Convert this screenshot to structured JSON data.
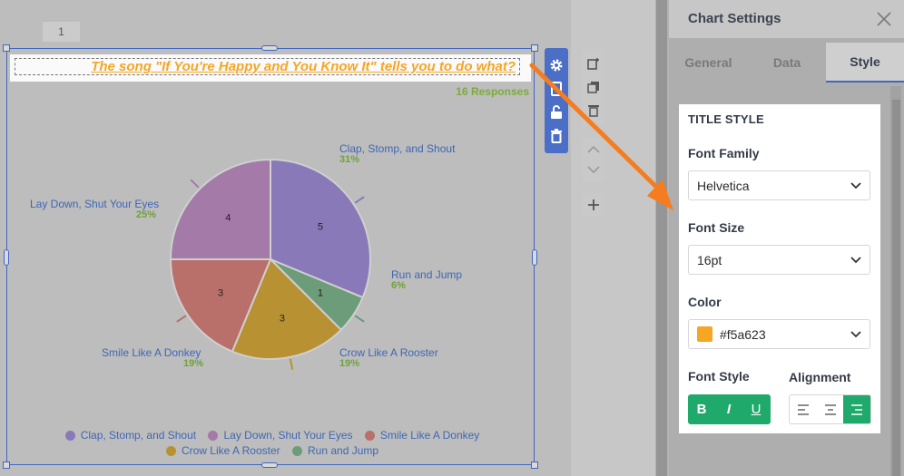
{
  "editor": {
    "page_number": "1",
    "question_title": "The song \"If You're Happy and You Know It\" tells you to do what?",
    "responses": "16 Responses"
  },
  "chart_data": {
    "type": "pie",
    "title": "The song \"If You're Happy and You Know It\" tells you to do what?",
    "categories": [
      "Clap, Stomp, and Shout",
      "Run and Jump",
      "Crow Like A Rooster",
      "Smile Like A Donkey",
      "Lay Down, Shut Your Eyes"
    ],
    "values": [
      5,
      1,
      3,
      3,
      4
    ],
    "percentages": [
      "31%",
      "6%",
      "19%",
      "19%",
      "25%"
    ],
    "colors": [
      "#8a79b9",
      "#6c9c79",
      "#b89133",
      "#b9706b",
      "#a47aa8"
    ],
    "legend_order": [
      "Clap, Stomp, and Shout",
      "Lay Down, Shut Your Eyes",
      "Smile Like A Donkey",
      "Crow Like A Rooster",
      "Run and Jump"
    ],
    "legend_position": "bottom"
  },
  "toolbar_icons": [
    "gear-icon",
    "copy-icon",
    "unlock-icon",
    "trash-icon"
  ],
  "aux_icons": [
    "add-image-icon",
    "duplicate-icon",
    "delete-icon",
    "chevron-up-icon",
    "chevron-down-icon",
    "plus-icon"
  ],
  "annotation": {
    "arrow_color": "#f57c1f"
  },
  "panel": {
    "title": "Chart Settings",
    "tabs": [
      "General",
      "Data",
      "Style"
    ],
    "active_tab": "Style",
    "section_title": "TITLE STYLE",
    "font_family": {
      "label": "Font Family",
      "value": "Helvetica"
    },
    "font_size": {
      "label": "Font Size",
      "value": "16pt"
    },
    "color": {
      "label": "Color",
      "value": "#f5a623"
    },
    "font_style": {
      "label": "Font Style",
      "bold": "B",
      "italic": "I",
      "underline": "U"
    },
    "alignment": {
      "label": "Alignment",
      "selected": "right"
    }
  },
  "theme": {
    "accent_green": "#1fa96b",
    "accent_blue": "#3f67c2",
    "title_color": "#f5a623"
  }
}
